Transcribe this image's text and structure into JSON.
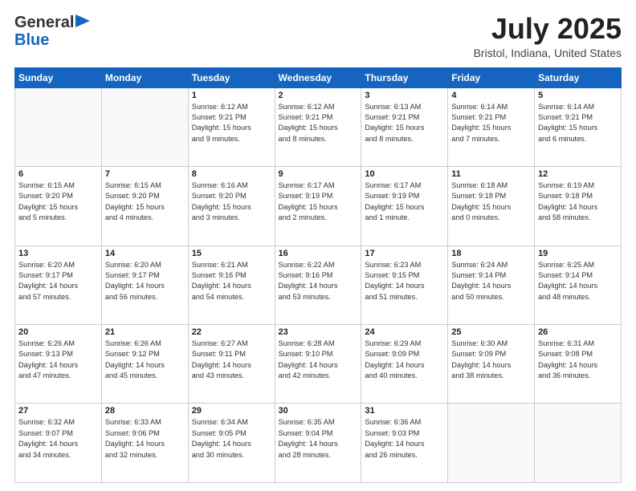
{
  "header": {
    "logo_line1": "General",
    "logo_line2": "Blue",
    "month": "July 2025",
    "location": "Bristol, Indiana, United States"
  },
  "weekdays": [
    "Sunday",
    "Monday",
    "Tuesday",
    "Wednesday",
    "Thursday",
    "Friday",
    "Saturday"
  ],
  "weeks": [
    [
      {
        "day": "",
        "info": ""
      },
      {
        "day": "",
        "info": ""
      },
      {
        "day": "1",
        "info": "Sunrise: 6:12 AM\nSunset: 9:21 PM\nDaylight: 15 hours\nand 9 minutes."
      },
      {
        "day": "2",
        "info": "Sunrise: 6:12 AM\nSunset: 9:21 PM\nDaylight: 15 hours\nand 8 minutes."
      },
      {
        "day": "3",
        "info": "Sunrise: 6:13 AM\nSunset: 9:21 PM\nDaylight: 15 hours\nand 8 minutes."
      },
      {
        "day": "4",
        "info": "Sunrise: 6:14 AM\nSunset: 9:21 PM\nDaylight: 15 hours\nand 7 minutes."
      },
      {
        "day": "5",
        "info": "Sunrise: 6:14 AM\nSunset: 9:21 PM\nDaylight: 15 hours\nand 6 minutes."
      }
    ],
    [
      {
        "day": "6",
        "info": "Sunrise: 6:15 AM\nSunset: 9:20 PM\nDaylight: 15 hours\nand 5 minutes."
      },
      {
        "day": "7",
        "info": "Sunrise: 6:15 AM\nSunset: 9:20 PM\nDaylight: 15 hours\nand 4 minutes."
      },
      {
        "day": "8",
        "info": "Sunrise: 6:16 AM\nSunset: 9:20 PM\nDaylight: 15 hours\nand 3 minutes."
      },
      {
        "day": "9",
        "info": "Sunrise: 6:17 AM\nSunset: 9:19 PM\nDaylight: 15 hours\nand 2 minutes."
      },
      {
        "day": "10",
        "info": "Sunrise: 6:17 AM\nSunset: 9:19 PM\nDaylight: 15 hours\nand 1 minute."
      },
      {
        "day": "11",
        "info": "Sunrise: 6:18 AM\nSunset: 9:18 PM\nDaylight: 15 hours\nand 0 minutes."
      },
      {
        "day": "12",
        "info": "Sunrise: 6:19 AM\nSunset: 9:18 PM\nDaylight: 14 hours\nand 58 minutes."
      }
    ],
    [
      {
        "day": "13",
        "info": "Sunrise: 6:20 AM\nSunset: 9:17 PM\nDaylight: 14 hours\nand 57 minutes."
      },
      {
        "day": "14",
        "info": "Sunrise: 6:20 AM\nSunset: 9:17 PM\nDaylight: 14 hours\nand 56 minutes."
      },
      {
        "day": "15",
        "info": "Sunrise: 6:21 AM\nSunset: 9:16 PM\nDaylight: 14 hours\nand 54 minutes."
      },
      {
        "day": "16",
        "info": "Sunrise: 6:22 AM\nSunset: 9:16 PM\nDaylight: 14 hours\nand 53 minutes."
      },
      {
        "day": "17",
        "info": "Sunrise: 6:23 AM\nSunset: 9:15 PM\nDaylight: 14 hours\nand 51 minutes."
      },
      {
        "day": "18",
        "info": "Sunrise: 6:24 AM\nSunset: 9:14 PM\nDaylight: 14 hours\nand 50 minutes."
      },
      {
        "day": "19",
        "info": "Sunrise: 6:25 AM\nSunset: 9:14 PM\nDaylight: 14 hours\nand 48 minutes."
      }
    ],
    [
      {
        "day": "20",
        "info": "Sunrise: 6:26 AM\nSunset: 9:13 PM\nDaylight: 14 hours\nand 47 minutes."
      },
      {
        "day": "21",
        "info": "Sunrise: 6:26 AM\nSunset: 9:12 PM\nDaylight: 14 hours\nand 45 minutes."
      },
      {
        "day": "22",
        "info": "Sunrise: 6:27 AM\nSunset: 9:11 PM\nDaylight: 14 hours\nand 43 minutes."
      },
      {
        "day": "23",
        "info": "Sunrise: 6:28 AM\nSunset: 9:10 PM\nDaylight: 14 hours\nand 42 minutes."
      },
      {
        "day": "24",
        "info": "Sunrise: 6:29 AM\nSunset: 9:09 PM\nDaylight: 14 hours\nand 40 minutes."
      },
      {
        "day": "25",
        "info": "Sunrise: 6:30 AM\nSunset: 9:09 PM\nDaylight: 14 hours\nand 38 minutes."
      },
      {
        "day": "26",
        "info": "Sunrise: 6:31 AM\nSunset: 9:08 PM\nDaylight: 14 hours\nand 36 minutes."
      }
    ],
    [
      {
        "day": "27",
        "info": "Sunrise: 6:32 AM\nSunset: 9:07 PM\nDaylight: 14 hours\nand 34 minutes."
      },
      {
        "day": "28",
        "info": "Sunrise: 6:33 AM\nSunset: 9:06 PM\nDaylight: 14 hours\nand 32 minutes."
      },
      {
        "day": "29",
        "info": "Sunrise: 6:34 AM\nSunset: 9:05 PM\nDaylight: 14 hours\nand 30 minutes."
      },
      {
        "day": "30",
        "info": "Sunrise: 6:35 AM\nSunset: 9:04 PM\nDaylight: 14 hours\nand 28 minutes."
      },
      {
        "day": "31",
        "info": "Sunrise: 6:36 AM\nSunset: 9:03 PM\nDaylight: 14 hours\nand 26 minutes."
      },
      {
        "day": "",
        "info": ""
      },
      {
        "day": "",
        "info": ""
      }
    ]
  ]
}
